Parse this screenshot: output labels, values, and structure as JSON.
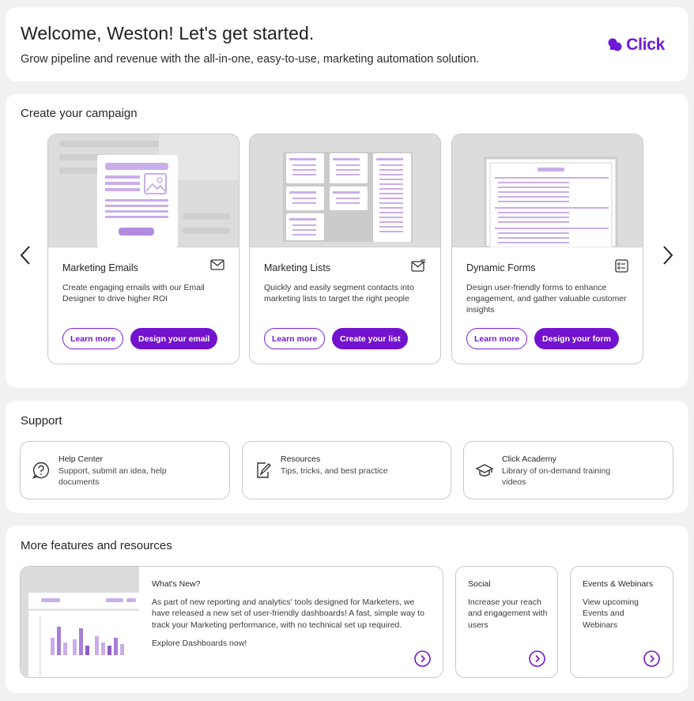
{
  "header": {
    "title": "Welcome, Weston! Let's get started.",
    "subtitle": "Grow pipeline and revenue with the all-in-one, easy-to-use, marketing automation solution.",
    "logo_text": "Click",
    "brand_color": "#6e1ad6"
  },
  "campaign": {
    "title": "Create your campaign",
    "cards": [
      {
        "title": "Marketing Emails",
        "icon": "envelope-icon",
        "description": "Create engaging emails with our Email Designer to drive higher ROI",
        "learn_label": "Learn more",
        "action_label": "Design your email"
      },
      {
        "title": "Marketing Lists",
        "icon": "envelope-list-icon",
        "description": "Quickly and easily segment contacts into marketing lists to target the right people",
        "learn_label": "Learn more",
        "action_label": "Create your list"
      },
      {
        "title": "Dynamic Forms",
        "icon": "form-icon",
        "description": "Design user-friendly forms to enhance engagement, and gather valuable customer insights",
        "learn_label": "Learn more",
        "action_label": "Design your form"
      }
    ]
  },
  "support": {
    "title": "Support",
    "items": [
      {
        "title": "Help Center",
        "description": "Support, submit an idea, help documents",
        "icon": "question-circle-icon"
      },
      {
        "title": "Resources",
        "description": "Tips, tricks, and best practice",
        "icon": "edit-document-icon"
      },
      {
        "title": "Click Academy",
        "description": "Library of on-demand training videos",
        "icon": "graduation-cap-icon"
      }
    ]
  },
  "features": {
    "title": "More features and resources",
    "whats_new": {
      "title": "What's New?",
      "description": "As part of new reporting and analytics' tools designed for Marketers, we have released a new set of user-friendly dashboards! A fast, simple way to track your Marketing performance, with no technical set up required.",
      "link": "Explore Dashboards now!"
    },
    "social": {
      "title": "Social",
      "description": "Increase your reach and engagement with users"
    },
    "events": {
      "title": "Events & Webinars",
      "description": "View upcoming Events and Webinars"
    }
  }
}
